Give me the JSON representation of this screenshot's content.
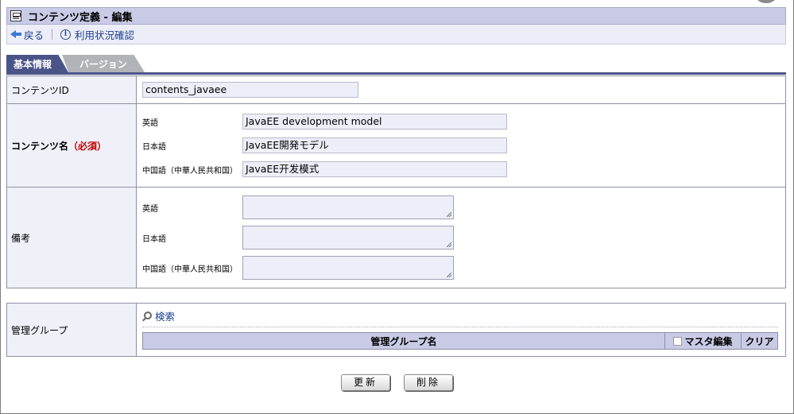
{
  "window": {
    "title": "コンテンツ定義 - 編集"
  },
  "toolbar": {
    "back_label": "戻る",
    "usage_label": "利用状況確認"
  },
  "tabs": [
    {
      "label": "基本情報",
      "active": true
    },
    {
      "label": "バージョン",
      "active": false
    }
  ],
  "form": {
    "content_id_label": "コンテンツID",
    "content_id_value": "contents_javaee",
    "content_name_label": "コンテンツ名",
    "required_label": "（必須）",
    "names": [
      {
        "lang": "英語",
        "value": "JavaEE development model"
      },
      {
        "lang": "日本語",
        "value": "JavaEE開発モデル"
      },
      {
        "lang": "中国語（中華人民共和国）",
        "value": "JavaEE开发模式"
      }
    ],
    "remarks_label": "備考",
    "remarks": [
      {
        "lang": "英語",
        "value": ""
      },
      {
        "lang": "日本語",
        "value": ""
      },
      {
        "lang": "中国語（中華人民共和国）",
        "value": ""
      }
    ]
  },
  "group": {
    "label": "管理グループ",
    "search_label": "検索",
    "columns": {
      "name": "管理グループ名",
      "master_edit": "マスタ編集",
      "clear": "クリア"
    }
  },
  "buttons": {
    "update": "更新",
    "delete": "削除"
  }
}
